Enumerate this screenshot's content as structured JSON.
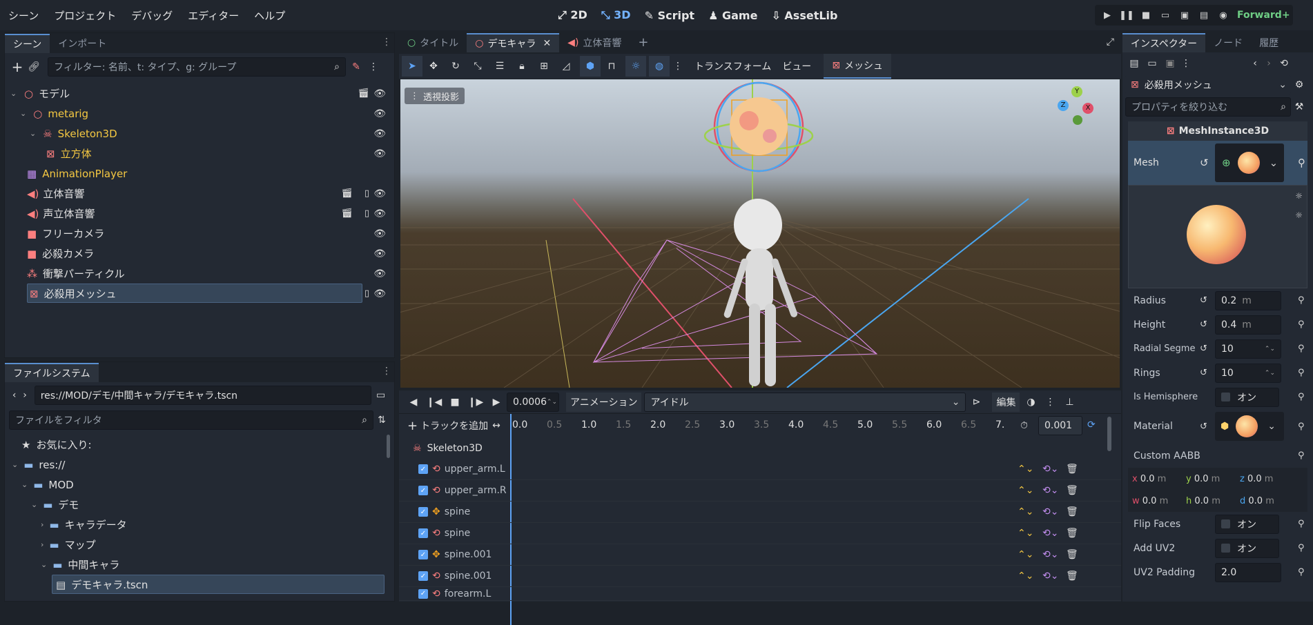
{
  "menu": [
    "シーン",
    "プロジェクト",
    "デバッグ",
    "エディター",
    "ヘルプ"
  ],
  "workspaces": [
    "2D",
    "3D",
    "Script",
    "Game",
    "AssetLib"
  ],
  "renderer": "Forward+",
  "scene_panel": {
    "tabs": [
      "シーン",
      "インポート"
    ],
    "filter_placeholder": "フィルター: 名前、t: タイプ、g: グループ",
    "nodes": [
      "モデル",
      "metarig",
      "Skeleton3D",
      "立方体",
      "AnimationPlayer",
      "立体音響",
      "声立体音響",
      "フリーカメラ",
      "必殺カメラ",
      "衝撃パーティクル",
      "必殺用メッシュ"
    ]
  },
  "filesystem": {
    "tab": "ファイルシステム",
    "path": "res://MOD/デモ/中間キャラ/デモキャラ.tscn",
    "filter_placeholder": "ファイルをフィルタ",
    "items": [
      "お気に入り:",
      "res://",
      "MOD",
      "デモ",
      "キャラデータ",
      "マップ",
      "中間キャラ",
      "デモキャラ.tscn"
    ]
  },
  "editor_tabs": [
    "タイトル",
    "デモキャラ",
    "立体音響"
  ],
  "viewport_toolbar": {
    "transform": "トランスフォーム",
    "view": "ビュー",
    "mesh": "メッシュ"
  },
  "viewport": {
    "projection": "透視投影",
    "gizmo": {
      "y": "Y",
      "x": "X",
      "z": "Z"
    }
  },
  "animation": {
    "time": "0.0006",
    "animation_menu": "アニメーション",
    "current": "アイドル",
    "edit": "編集",
    "add_track": "トラックを追加",
    "ticks": [
      "0.0",
      "0.5",
      "1.0",
      "1.5",
      "2.0",
      "2.5",
      "3.0",
      "3.5",
      "4.0",
      "4.5",
      "5.0",
      "5.5",
      "6.0",
      "6.5",
      "7."
    ],
    "snap": "0.001",
    "group": "Skeleton3D",
    "tracks": [
      "upper_arm.L",
      "upper_arm.R",
      "spine",
      "spine",
      "spine.001",
      "spine.001",
      "forearm.L"
    ]
  },
  "inspector": {
    "tabs": [
      "インスペクター",
      "ノード",
      "履歴"
    ],
    "object": "必殺用メッシュ",
    "filter_placeholder": "プロパティを絞り込む",
    "class": "MeshInstance3D",
    "mesh_label": "Mesh",
    "props": {
      "radius": {
        "label": "Radius",
        "value": "0.2",
        "unit": "m"
      },
      "height": {
        "label": "Height",
        "value": "0.4",
        "unit": "m"
      },
      "radial": {
        "label": "Radial Segme",
        "value": "10"
      },
      "rings": {
        "label": "Rings",
        "value": "10"
      },
      "hemi": {
        "label": "Is Hemisphere",
        "value": "オン"
      },
      "material": {
        "label": "Material"
      },
      "aabb": {
        "label": "Custom AABB",
        "x": "0.0",
        "y": "0.0",
        "z": "0.0",
        "w": "0.0",
        "h": "0.0",
        "d": "0.0",
        "unit": "m"
      },
      "flip": {
        "label": "Flip Faces",
        "value": "オン"
      },
      "uv2": {
        "label": "Add UV2",
        "value": "オン"
      },
      "uv2pad": {
        "label": "UV2 Padding",
        "value": "2.0"
      }
    }
  },
  "colors": {
    "accent": "#5ea3f5",
    "active_ws": "#74b3ff",
    "node_red": "#fc7f7f",
    "node_yellow": "#f5c842"
  }
}
